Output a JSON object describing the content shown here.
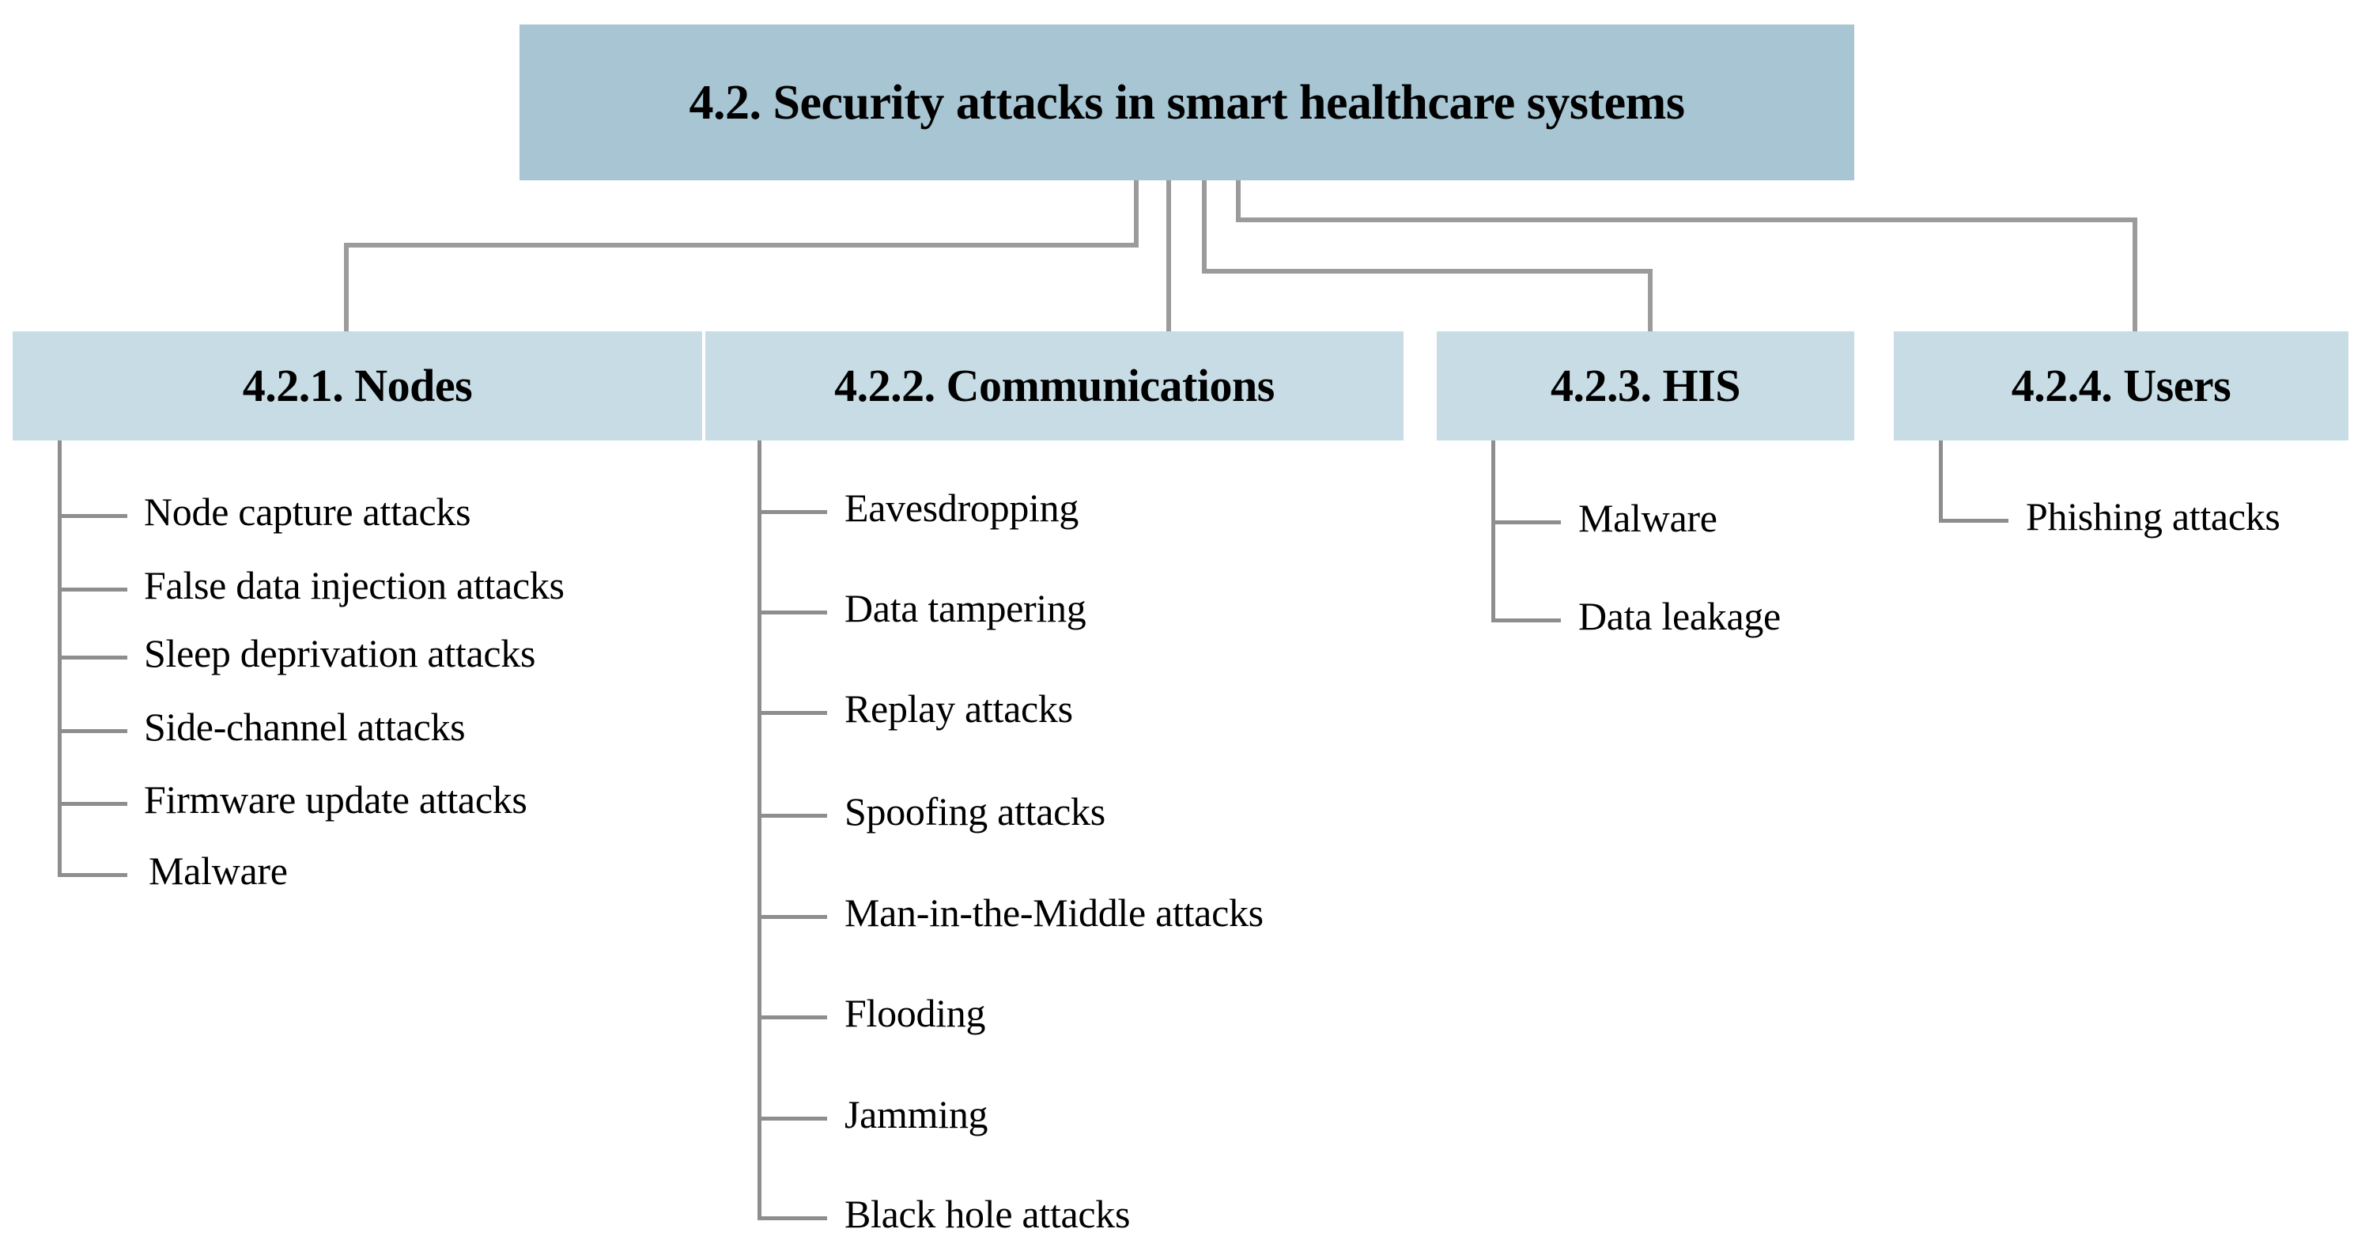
{
  "diagram": {
    "root": {
      "label": "4.2. Security attacks in smart healthcare systems"
    },
    "categories": [
      {
        "id": "nodes",
        "label": "4.2.1. Nodes",
        "items": [
          "Node capture attacks",
          "False data injection attacks",
          "Sleep deprivation attacks",
          "Side-channel attacks",
          "Firmware update attacks",
          "Malware"
        ]
      },
      {
        "id": "communications",
        "label": "4.2.2. Communications",
        "items": [
          "Eavesdropping",
          "Data tampering",
          "Replay attacks",
          "Spoofing attacks",
          "Man-in-the-Middle attacks",
          "Flooding",
          "Jamming",
          "Black hole attacks"
        ]
      },
      {
        "id": "his",
        "label": "4.2.3. HIS",
        "items": [
          "Malware",
          "Data leakage"
        ]
      },
      {
        "id": "users",
        "label": "4.2.4. Users",
        "items": [
          "Phishing attacks"
        ]
      }
    ]
  },
  "colors": {
    "root_box": "#a7c5d2",
    "category_box": "#c7dce4",
    "connector": "#9b9b9b",
    "leaf_connector": "#8e8e8e",
    "text": "#000000",
    "background": "#ffffff"
  }
}
